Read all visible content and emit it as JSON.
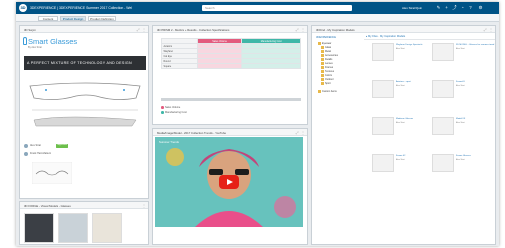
{
  "app": {
    "logo_text": "3D",
    "title": "3DEXPERIENCE | 3DEXPERIENCE Summer 2017 Collection - Wel",
    "search_placeholder": "Search",
    "user_name": "Alex Strat/Quin"
  },
  "tabs": [
    {
      "label": "Content",
      "active": false
    },
    {
      "label": "Product Design",
      "active": true
    },
    {
      "label": "Product Definition",
      "active": false
    }
  ],
  "panels": {
    "wiki": {
      "title": "3D Swym",
      "heading": "Smart Glasses",
      "byline": "By Alex Strat",
      "banner": "A PERFECT MIXTURE OF TECHNOLOGY AND DESIGN",
      "posts": [
        {
          "text": "Alex Strat",
          "badge": "Approved"
        },
        {
          "text": "Frank Hart-Mattern",
          "badge": ""
        }
      ]
    },
    "table": {
      "title": "3D PRISM 2 - Metrics + Results - Collection Specifications",
      "headers": [
        "Sales Volume",
        "Manufacturing Cost"
      ],
      "rows": [
        "Aviators",
        "Wayfarer",
        "Cat Eye",
        "Round",
        "Square"
      ],
      "legend": [
        "Sales Volume",
        "Manufacturing Cost"
      ]
    },
    "video": {
      "title": "Media/Image/Model - 2017 Collection Trends - YouTube",
      "overlay": "Summer Trends"
    },
    "library": {
      "title": "3DFind - My Inspiration Models",
      "tree": [
        "Eyewear",
        "Glass",
        "Metal",
        "Accessories",
        "Details",
        "Lenses",
        "Frames",
        "Textures",
        "Colors",
        "Outdoor",
        "Sport",
        "Custom Items"
      ],
      "items": [
        {
          "name": "Wayfarer Design Spectacle",
          "sub": "Alex Strat"
        },
        {
          "name": "3D MODEL - Glasses for summer trend",
          "sub": "Alex Strat"
        },
        {
          "name": "Aviators - sport",
          "sub": "Alex Strat"
        },
        {
          "name": "Frame01",
          "sub": "Alex Strat"
        },
        {
          "name": "Moderne Glasses",
          "sub": "Alex Strat"
        },
        {
          "name": "Model FF",
          "sub": "Alex Strat"
        },
        {
          "name": "Frame 02",
          "sub": "Alex Strat"
        },
        {
          "name": "Frame Glasses",
          "sub": "Alex Strat"
        }
      ]
    },
    "gallery": {
      "title": "3D FORGE - Visual Models - Glasses"
    }
  },
  "colors": {
    "brand": "#005386",
    "accent_pink": "#e35b7e",
    "accent_teal": "#3fb7a8"
  }
}
